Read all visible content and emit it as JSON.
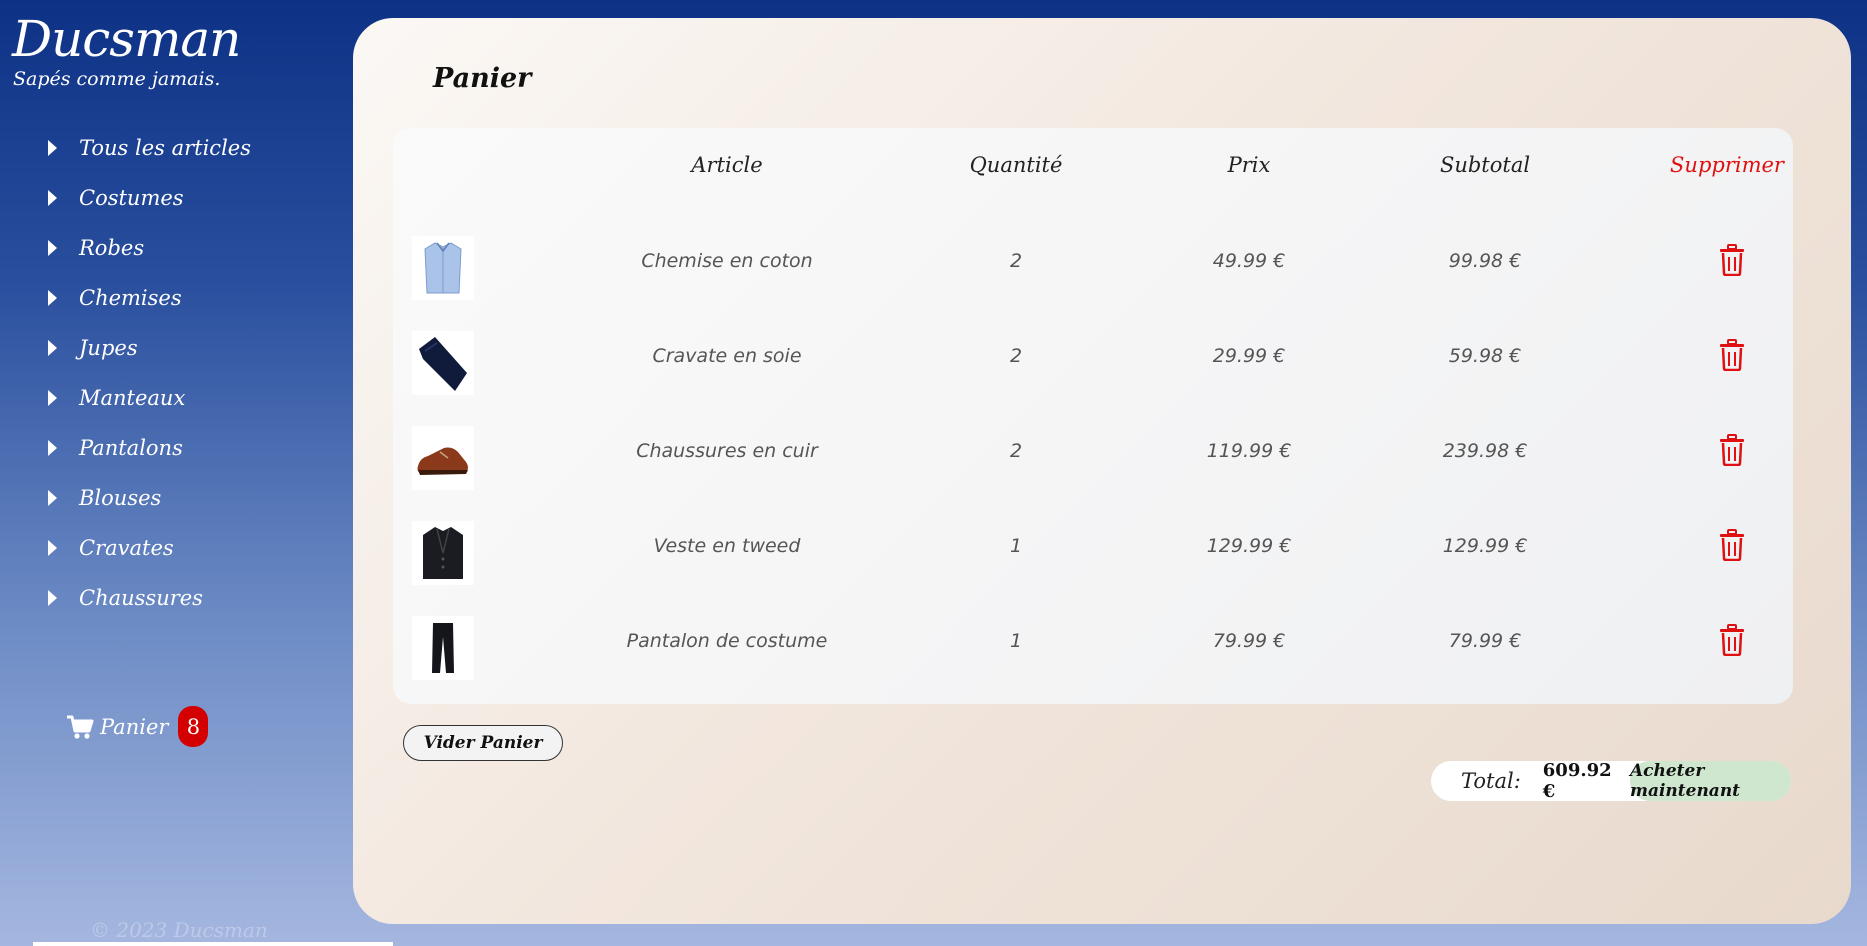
{
  "brand": {
    "name": "Ducsman",
    "tagline": "Sapés comme jamais."
  },
  "sidebar": {
    "items": [
      {
        "label": "Tous les articles"
      },
      {
        "label": "Costumes"
      },
      {
        "label": "Robes"
      },
      {
        "label": "Chemises"
      },
      {
        "label": "Jupes"
      },
      {
        "label": "Manteaux"
      },
      {
        "label": "Pantalons"
      },
      {
        "label": "Blouses"
      },
      {
        "label": "Cravates"
      },
      {
        "label": "Chaussures"
      }
    ],
    "cart": {
      "label": "Panier",
      "count": "8",
      "icon": "cart-icon"
    },
    "copyright": "© 2023 Ducsman"
  },
  "main": {
    "title": "Panier",
    "table": {
      "headers": {
        "article": "Article",
        "quantity": "Quantité",
        "price": "Prix",
        "subtotal": "Subtotal",
        "delete": "Supprimer"
      },
      "rows": [
        {
          "name": "Chemise en coton",
          "qty": "2",
          "price": "49.99 €",
          "subtotal": "99.98 €",
          "image": "shirt"
        },
        {
          "name": "Cravate en soie",
          "qty": "2",
          "price": "29.99 €",
          "subtotal": "59.98 €",
          "image": "tie"
        },
        {
          "name": "Chaussures en cuir",
          "qty": "2",
          "price": "119.99 €",
          "subtotal": "239.98 €",
          "image": "shoe"
        },
        {
          "name": "Veste en tweed",
          "qty": "1",
          "price": "129.99 €",
          "subtotal": "129.99 €",
          "image": "jacket"
        },
        {
          "name": "Pantalon de costume",
          "qty": "1",
          "price": "79.99 €",
          "subtotal": "79.99 €",
          "image": "trousers"
        }
      ]
    },
    "clear_button": "Vider Panier",
    "total": {
      "label": "Total:",
      "value": "609.92 €",
      "buy_button": "Acheter maintenant"
    }
  },
  "colors": {
    "accent_red": "#e01010",
    "badge_red": "#d40000",
    "buy_green": "#cfe6cf",
    "sidebar_top": "#0d3185"
  }
}
